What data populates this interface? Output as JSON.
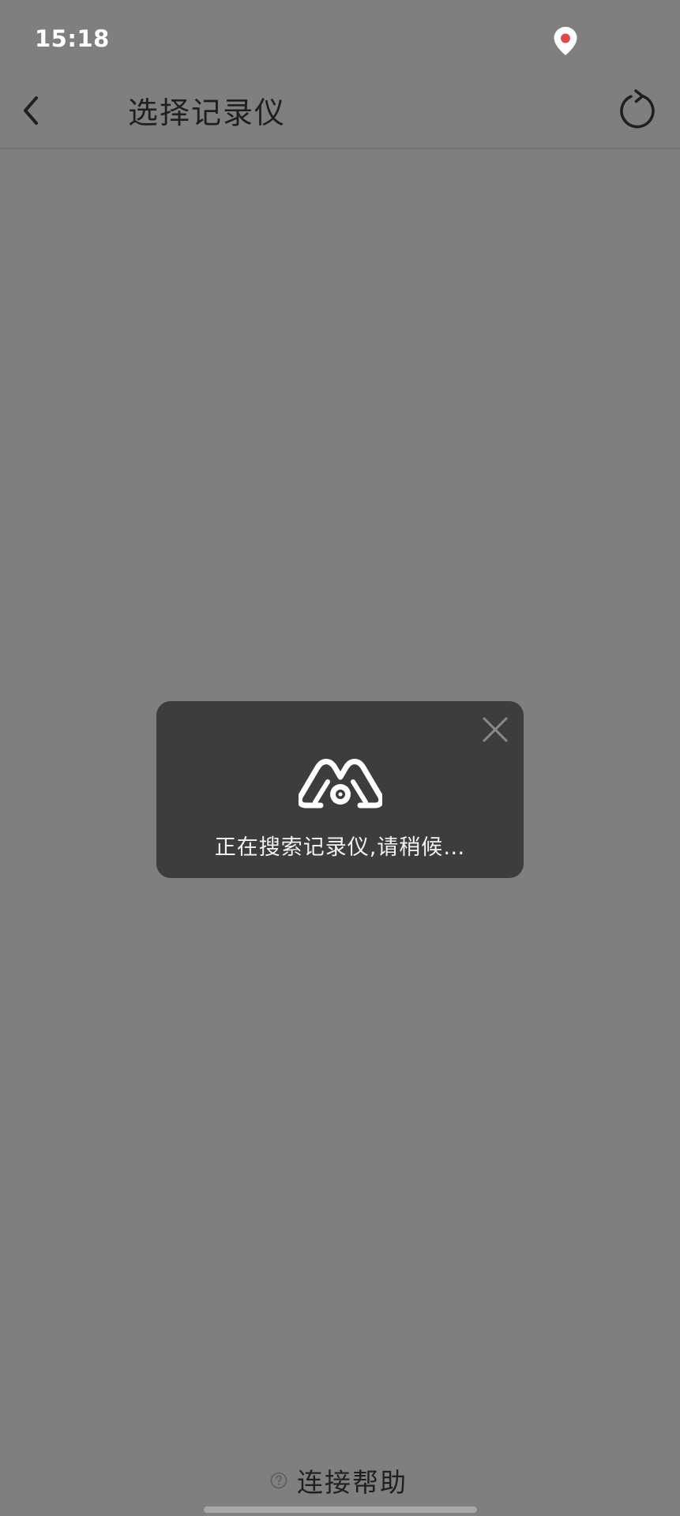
{
  "status_bar": {
    "time": "15:18",
    "location_icon": "location-pin-icon",
    "location_dot_color": "#e24a4a"
  },
  "header": {
    "back_icon": "chevron-left-icon",
    "title": "选择记录仪",
    "refresh_icon": "refresh-icon"
  },
  "loading_dialog": {
    "close_icon": "close-icon",
    "logo_icon": "brand-logo-icon",
    "message": "正在搜索记录仪,请稍候…"
  },
  "footer": {
    "help_icon": "question-circle-icon",
    "help_label": "连接帮助"
  },
  "colors": {
    "overlay_background": "#7f7f7f",
    "dialog_background": "#3d3d3d",
    "title_text": "#1f1f1f"
  }
}
